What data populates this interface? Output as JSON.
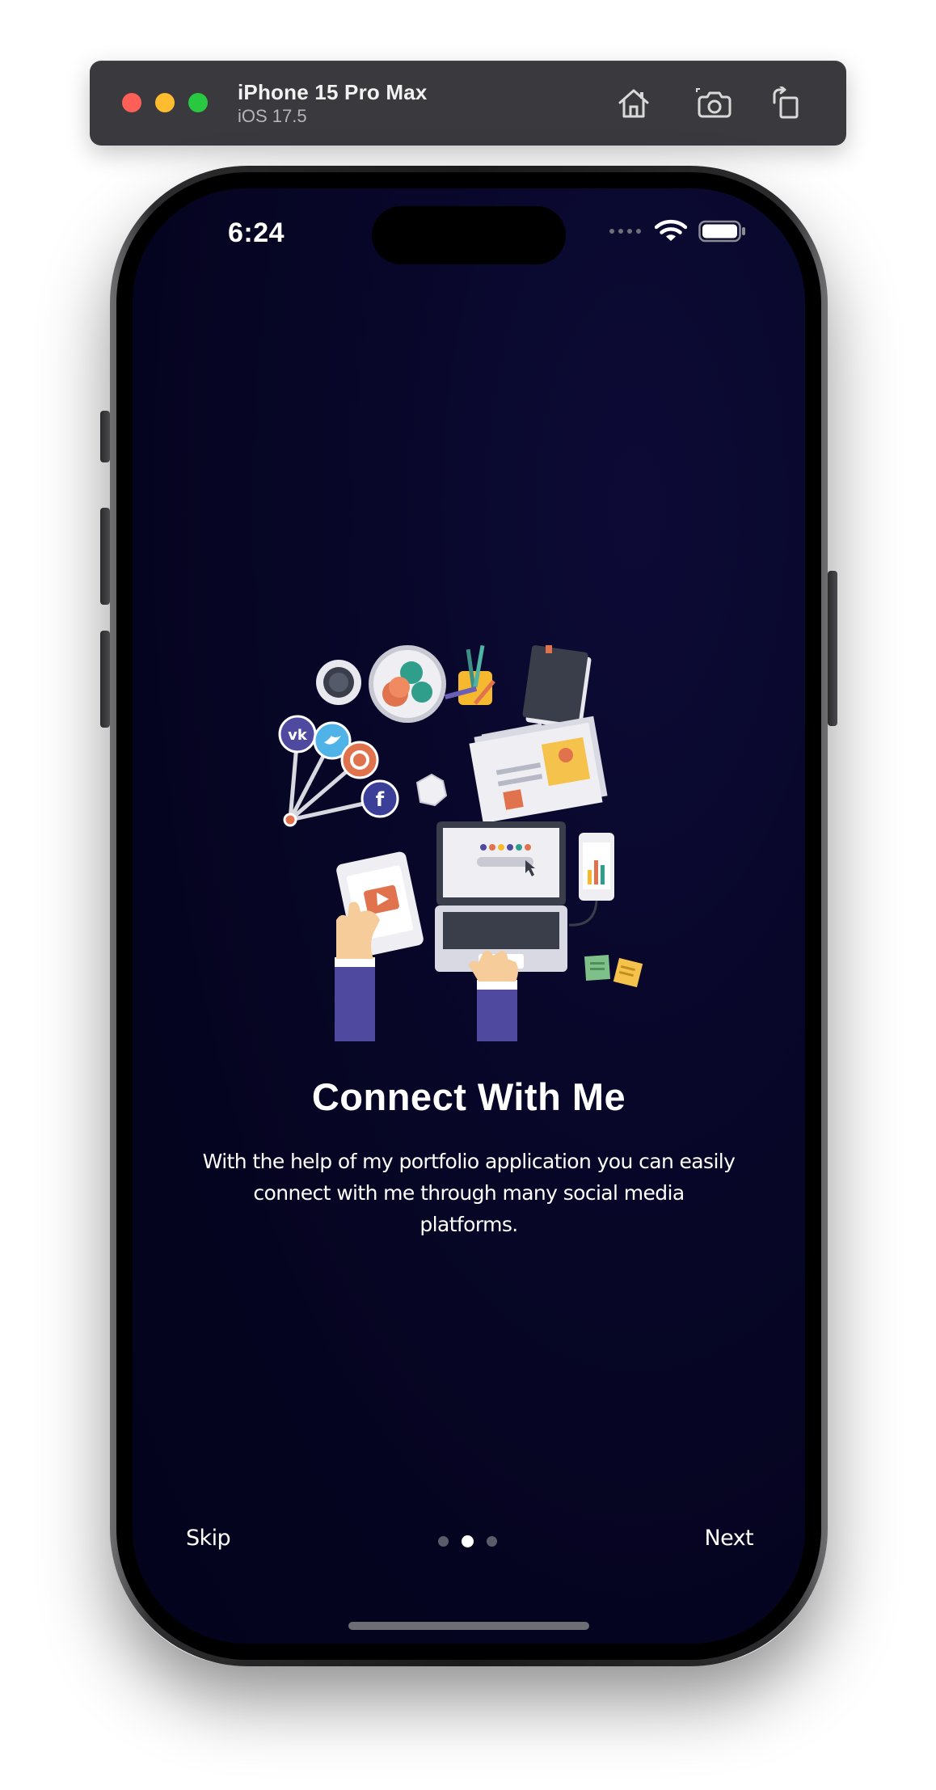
{
  "simulator": {
    "device_name": "iPhone 15 Pro Max",
    "os_version": "iOS 17.5",
    "buttons": [
      "home-icon",
      "screenshot-icon",
      "rotate-icon"
    ],
    "traffic_lights": {
      "close": "#fe5f57",
      "minimize": "#febc2e",
      "zoom": "#28c840"
    }
  },
  "status_bar": {
    "time": "6:24",
    "icons": [
      "cellular-signal-icon",
      "wifi-icon",
      "battery-icon"
    ]
  },
  "onboarding": {
    "title": "Connect With Me",
    "description": "With the help of my portfolio application you can easily connect with me through many social media platforms.",
    "skip_label": "Skip",
    "next_label": "Next",
    "page_count": 3,
    "current_page": 2,
    "illustration": "workspace-social-media-illustration"
  },
  "colors": {
    "screen_background": "#05041f",
    "text": "#ffffff",
    "dot_inactive": "#5b5b6a",
    "dot_active": "#ffffff"
  }
}
